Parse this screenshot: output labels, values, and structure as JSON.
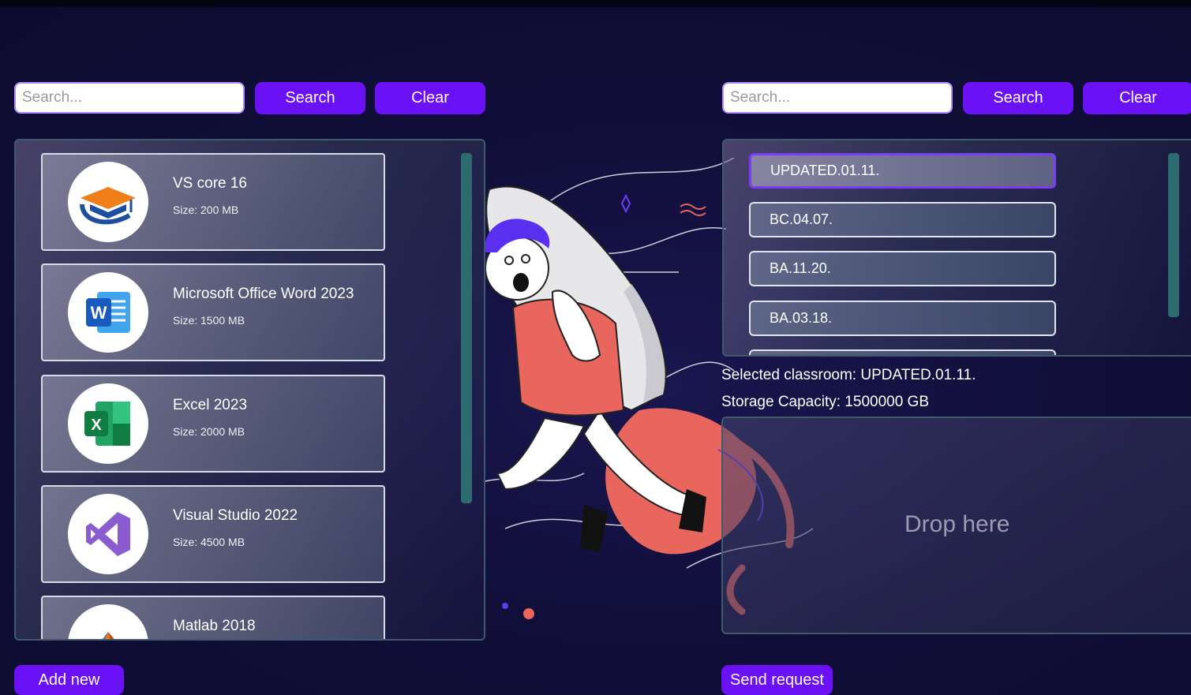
{
  "left": {
    "search_placeholder": "Search...",
    "search_label": "Search",
    "clear_label": "Clear",
    "apps": [
      {
        "name": "VS core 16",
        "size": "Size: 200 MB",
        "icon": "graduation-cap-icon"
      },
      {
        "name": "Microsoft Office Word 2023",
        "size": "Size: 1500 MB",
        "icon": "word-icon"
      },
      {
        "name": "Excel 2023",
        "size": "Size: 2000 MB",
        "icon": "excel-icon"
      },
      {
        "name": "Visual Studio 2022",
        "size": "Size: 4500 MB",
        "icon": "visual-studio-icon"
      },
      {
        "name": "Matlab 2018",
        "size": "",
        "icon": "matlab-icon"
      }
    ],
    "add_label": "Add new"
  },
  "right": {
    "search_placeholder": "Search...",
    "search_label": "Search",
    "clear_label": "Clear",
    "classrooms": [
      "UPDATED.01.11.",
      "BC.04.07.",
      "BA.11.20.",
      "BA.03.18."
    ],
    "selected_text": "Selected classroom: UPDATED.01.11.",
    "storage_text": "Storage Capacity: 1500000 GB",
    "drop_label": "Drop here",
    "send_label": "Send request"
  },
  "colors": {
    "accent": "#6a12f5",
    "background": "#0d0b2e",
    "scrollbar": "#2e6b6e"
  }
}
